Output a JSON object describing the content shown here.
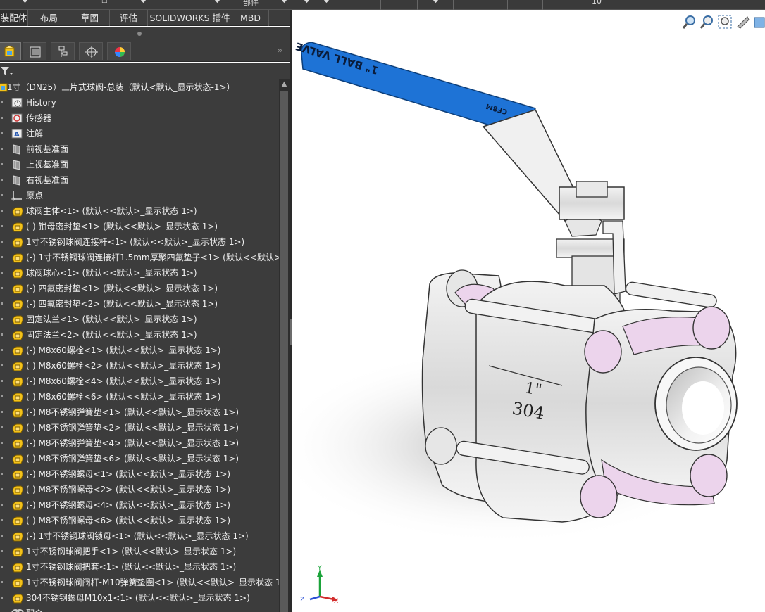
{
  "toolbar_top": {
    "label_left": "部件",
    "label_right": "10"
  },
  "command_tabs": [
    {
      "label": "装配体",
      "active": true
    },
    {
      "label": "布局",
      "active": false
    },
    {
      "label": "草图",
      "active": false
    },
    {
      "label": "评估",
      "active": false
    },
    {
      "label": "SOLIDWORKS 插件",
      "active": false
    },
    {
      "label": "MBD",
      "active": false
    }
  ],
  "feature_manager_tabs": [
    {
      "icon": "feature-tree-icon",
      "active": true
    },
    {
      "icon": "property-manager-icon",
      "active": false
    },
    {
      "icon": "configuration-manager-icon",
      "active": false
    },
    {
      "icon": "dimxpert-icon",
      "active": false
    },
    {
      "icon": "display-manager-icon",
      "active": false
    }
  ],
  "tree": [
    {
      "label": "1寸（DN25）三片式球阀-总装（默认<默认_显示状态-1>）",
      "icon": "assembly-icon",
      "indent": 0
    },
    {
      "label": "History",
      "icon": "history-icon",
      "indent": 1
    },
    {
      "label": "传感器",
      "icon": "sensor-icon",
      "indent": 1
    },
    {
      "label": "注解",
      "icon": "annotation-icon",
      "indent": 1
    },
    {
      "label": "前视基准面",
      "icon": "plane-icon",
      "indent": 1
    },
    {
      "label": "上视基准面",
      "icon": "plane-icon",
      "indent": 1
    },
    {
      "label": "右视基准面",
      "icon": "plane-icon",
      "indent": 1
    },
    {
      "label": "原点",
      "icon": "origin-icon",
      "indent": 1
    },
    {
      "label": "球阀主体<1> (默认<<默认>_显示状态 1>)",
      "icon": "part-icon",
      "indent": 1
    },
    {
      "label": "(-) 锁母密封垫<1> (默认<<默认>_显示状态 1>)",
      "icon": "part-icon",
      "indent": 1
    },
    {
      "label": "1寸不锈钢球阀连接杆<1> (默认<<默认>_显示状态 1>)",
      "icon": "part-icon",
      "indent": 1
    },
    {
      "label": "(-) 1寸不锈钢球阀连接杆1.5mm厚聚四氟垫子<1> (默认<<默认>_",
      "icon": "part-icon",
      "indent": 1
    },
    {
      "label": "球阀球心<1> (默认<<默认>_显示状态 1>)",
      "icon": "part-icon",
      "indent": 1
    },
    {
      "label": "(-) 四氟密封垫<1> (默认<<默认>_显示状态 1>)",
      "icon": "part-icon",
      "indent": 1
    },
    {
      "label": "(-) 四氟密封垫<2> (默认<<默认>_显示状态 1>)",
      "icon": "part-icon",
      "indent": 1
    },
    {
      "label": "固定法兰<1> (默认<<默认>_显示状态 1>)",
      "icon": "part-icon",
      "indent": 1
    },
    {
      "label": "固定法兰<2> (默认<<默认>_显示状态 1>)",
      "icon": "part-icon",
      "indent": 1
    },
    {
      "label": "(-) M8x60螺栓<1> (默认<<默认>_显示状态 1>)",
      "icon": "part-icon",
      "indent": 1
    },
    {
      "label": "(-) M8x60螺栓<2> (默认<<默认>_显示状态 1>)",
      "icon": "part-icon",
      "indent": 1
    },
    {
      "label": "(-) M8x60螺栓<4> (默认<<默认>_显示状态 1>)",
      "icon": "part-icon",
      "indent": 1
    },
    {
      "label": "(-) M8x60螺栓<6> (默认<<默认>_显示状态 1>)",
      "icon": "part-icon",
      "indent": 1
    },
    {
      "label": "(-) M8不锈钢弹簧垫<1> (默认<<默认>_显示状态 1>)",
      "icon": "part-icon",
      "indent": 1
    },
    {
      "label": "(-) M8不锈钢弹簧垫<2> (默认<<默认>_显示状态 1>)",
      "icon": "part-icon",
      "indent": 1
    },
    {
      "label": "(-) M8不锈钢弹簧垫<4> (默认<<默认>_显示状态 1>)",
      "icon": "part-icon",
      "indent": 1
    },
    {
      "label": "(-) M8不锈钢弹簧垫<6> (默认<<默认>_显示状态 1>)",
      "icon": "part-icon",
      "indent": 1
    },
    {
      "label": "(-) M8不锈钢螺母<1> (默认<<默认>_显示状态 1>)",
      "icon": "part-icon",
      "indent": 1
    },
    {
      "label": "(-) M8不锈钢螺母<2> (默认<<默认>_显示状态 1>)",
      "icon": "part-icon",
      "indent": 1
    },
    {
      "label": "(-) M8不锈钢螺母<4> (默认<<默认>_显示状态 1>)",
      "icon": "part-icon",
      "indent": 1
    },
    {
      "label": "(-) M8不锈钢螺母<6> (默认<<默认>_显示状态 1>)",
      "icon": "part-icon",
      "indent": 1
    },
    {
      "label": "(-) 1寸不锈钢球阀锁母<1> (默认<<默认>_显示状态 1>)",
      "icon": "part-icon",
      "indent": 1
    },
    {
      "label": "1寸不锈钢球阀把手<1> (默认<<默认>_显示状态 1>)",
      "icon": "part-icon",
      "indent": 1
    },
    {
      "label": "1寸不锈钢球阀把套<1> (默认<<默认>_显示状态 1>)",
      "icon": "part-icon",
      "indent": 1
    },
    {
      "label": "1寸不锈钢球阀阀杆-M10弹簧垫圈<1> (默认<<默认>_显示状态 1>",
      "icon": "part-icon",
      "indent": 1
    },
    {
      "label": "304不锈钢螺母M10x1<1> (默认<<默认>_显示状态 1>)",
      "icon": "part-icon",
      "indent": 1
    },
    {
      "label": "配合",
      "icon": "mates-icon",
      "indent": 1
    }
  ],
  "model": {
    "handle_text": "1\" BALL VALVE",
    "handle_brand": "CF8M",
    "body_size": "1\"",
    "body_material": "304"
  },
  "triad": {
    "x": "X",
    "y": "Y",
    "z": "Z"
  },
  "colors": {
    "panel_bg": "#3c3c3c",
    "handle_blue": "#1e73d6",
    "seal_pink": "#ecd4ec",
    "part_icon_yellow": "#f3c21b",
    "text": "#f0f0f0"
  }
}
